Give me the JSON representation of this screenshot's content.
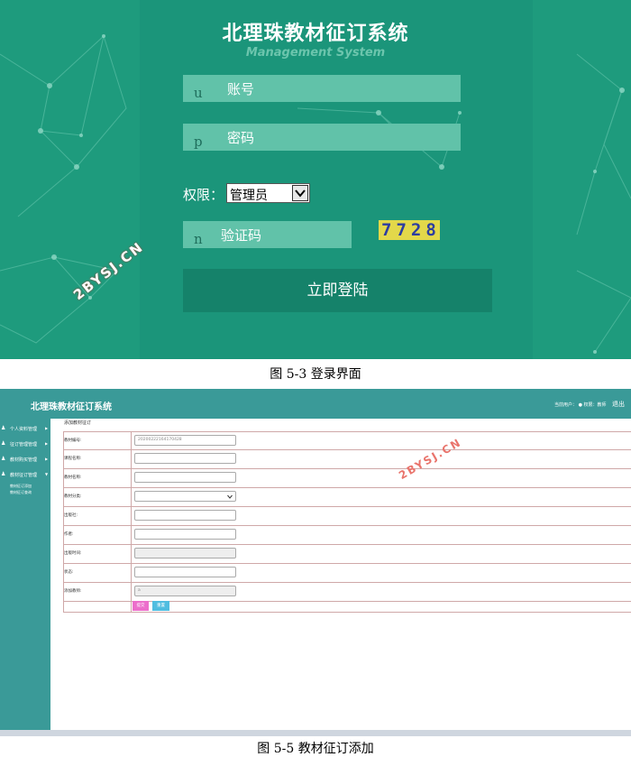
{
  "login": {
    "system_title": "北理珠教材征订系统",
    "system_subtitle": "Management System",
    "username_placeholder": "账号",
    "username_hint_glyph": "u",
    "password_placeholder": "密码",
    "password_hint_glyph": "p",
    "role_label": "权限：",
    "role_selected": "管理员",
    "captcha_placeholder": "验证码",
    "captcha_hint_glyph": "n",
    "captcha_code": "7728",
    "login_button": "立即登陆",
    "watermark": "2BYSJ.CN"
  },
  "caption_login": "图 5-3 登录界面",
  "admin": {
    "title": "北理珠教材征订系统",
    "user_info": "当前用户： ●  权限：教师",
    "exit_label": "退出",
    "sidebar": {
      "items": [
        {
          "label": "个人资料管理",
          "icon": "user-icon"
        },
        {
          "label": "征订管理管理",
          "icon": "user-icon"
        },
        {
          "label": "教材购买管理",
          "icon": "user-icon"
        },
        {
          "label": "教材征订管理",
          "icon": "user-icon"
        }
      ],
      "subitems": [
        "教材征订添加",
        "教材征订查询"
      ]
    },
    "breadcrumb": "添加教材征订",
    "form": {
      "fields": [
        {
          "label": "教材编号:",
          "value": "20200222164170428",
          "readonly": false,
          "type": "text"
        },
        {
          "label": "课程名称:",
          "value": "",
          "readonly": false,
          "type": "text"
        },
        {
          "label": "教材名称:",
          "value": "",
          "readonly": false,
          "type": "text"
        },
        {
          "label": "教材分类:",
          "value": "",
          "readonly": false,
          "type": "select"
        },
        {
          "label": "出版社:",
          "value": "",
          "readonly": false,
          "type": "text"
        },
        {
          "label": "作者:",
          "value": "",
          "readonly": false,
          "type": "text"
        },
        {
          "label": "出版时间:",
          "value": "",
          "readonly": true,
          "type": "text"
        },
        {
          "label": "状态:",
          "value": "",
          "readonly": false,
          "type": "text"
        },
        {
          "label": "添加教师:",
          "value": "a",
          "readonly": true,
          "type": "text"
        }
      ],
      "submit_label": "提交",
      "reset_label": "重置"
    },
    "watermark": "2BYSJ.CN"
  },
  "caption_admin": "图 5-5 教材征订添加",
  "colors": {
    "login_bg": "#1e9b7d",
    "login_field": "#61c2a9",
    "login_button": "#15826a",
    "admin_header": "#3a9a98",
    "submit": "#ec6fcb",
    "reset": "#50bde0"
  }
}
